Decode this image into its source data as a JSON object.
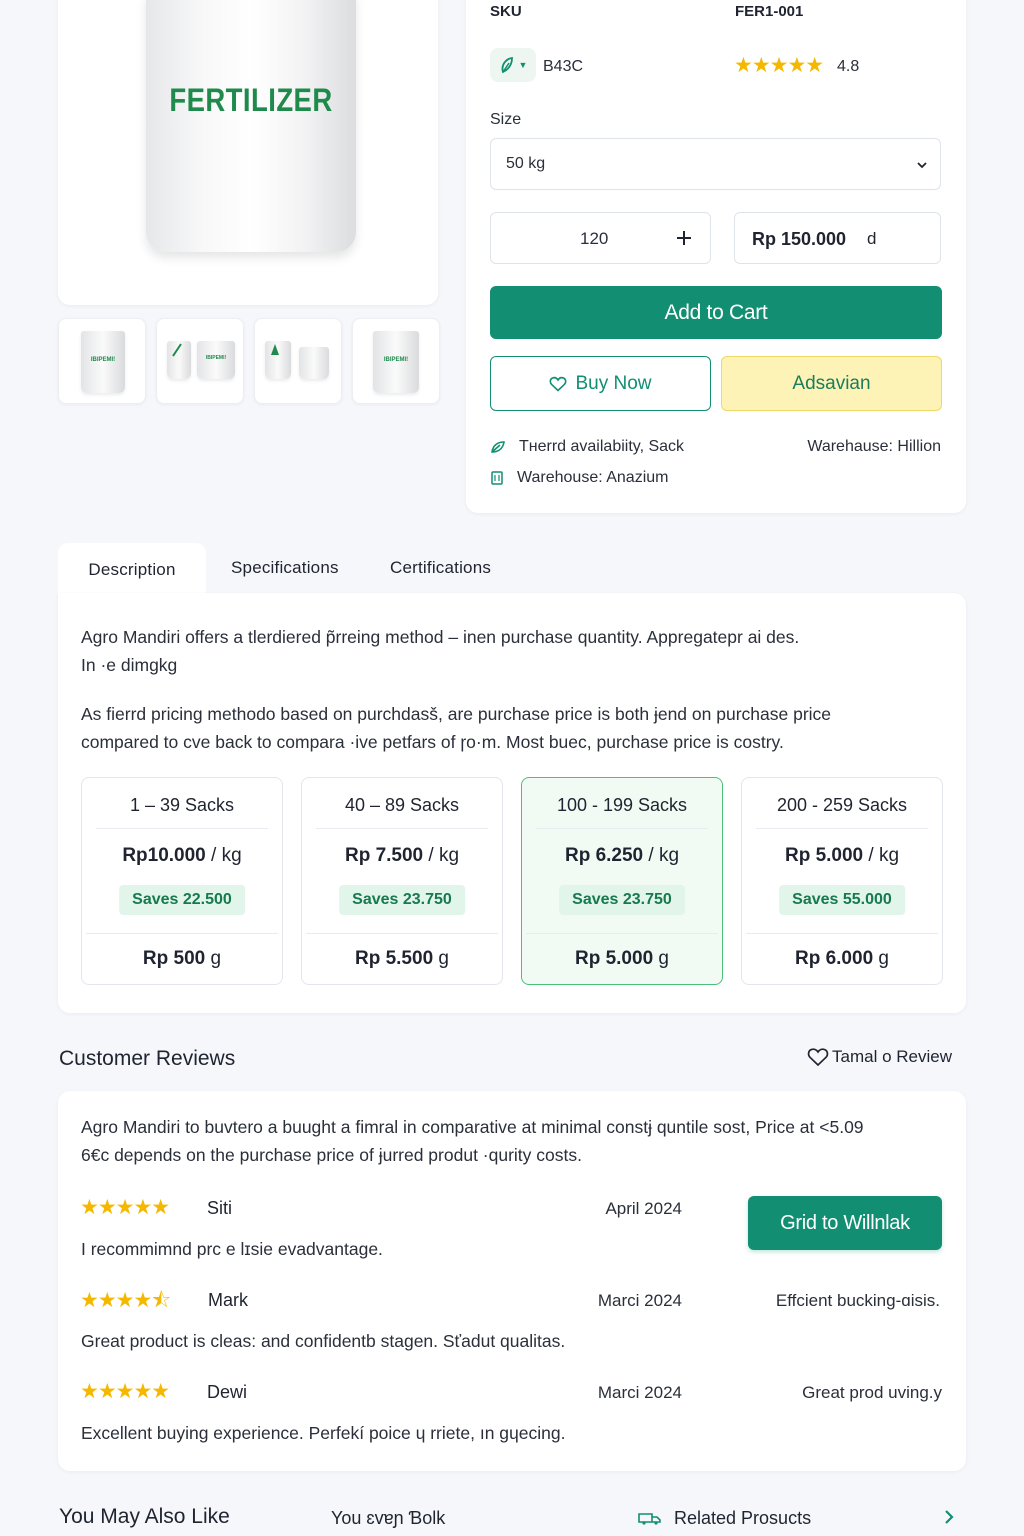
{
  "product": {
    "bag_label": "FERTILIZER",
    "thumb_labels": [
      "IBIPEMI!",
      "IBIPEMI!",
      "",
      "IBIPEMI!"
    ]
  },
  "info": {
    "sku_label": "SKU",
    "sku_value": "FER1-001",
    "chip_icon": "leaf-icon",
    "code": "B43C",
    "rating_stars": "★★★★★",
    "rating_value": "4.8",
    "size_label": "Size",
    "size_selected": "50 kg",
    "quantity": "120",
    "price": "Rp 150.000",
    "price_suffix": "d",
    "add_to_cart": "Add to Cart",
    "buy_now": "Buy Now",
    "advanced": "Adsavian",
    "availability": "Tнerrd availabiity, Sack",
    "warehouse_right": "Warehause: Hillion",
    "warehouse_left": "Warehouse: Anazium"
  },
  "tabs": [
    "Description",
    "Specifications",
    "Certifications"
  ],
  "description": {
    "p1_line1": "Agro Mandiri offers a tlerdiered p̃rreing method – inen purchase quantity. Appregatepr ai des.",
    "p1_line2": "In ·e dimgkg",
    "p2_line1": "As fierrd pricing methodo based on purchdasš, are purchase price is both ɉend on purchase price",
    "p2_line2": "compared to cve back to compara ·ive petfars of ɼo·m. Most buec, purchase price is costry."
  },
  "tiers": [
    {
      "range": "1 – 39 Sacks",
      "price": "Rp10.000",
      "unit": " / kg",
      "save": "Saves 22.500",
      "bottom": "Rp 500",
      "bottom_unit": " g",
      "selected": false
    },
    {
      "range": "40 – 89 Sacks",
      "price": "Rp 7.500",
      "unit": " / kg",
      "save": "Saves 23.750",
      "bottom": "Rp 5.500",
      "bottom_unit": " g",
      "selected": false
    },
    {
      "range": "100 - 199 Sacks",
      "price": "Rp 6.250",
      "unit": " / kg",
      "save": "Saves 23.750",
      "bottom": "Rp 5.000",
      "bottom_unit": " g",
      "selected": true
    },
    {
      "range": "200 - 259 Sacks",
      "price": "Rp 5.000",
      "unit": " / kg",
      "save": "Saves 55.000",
      "bottom": "Rp 6.000",
      "bottom_unit": " g",
      "selected": false
    }
  ],
  "reviews": {
    "title": "Customer Reviews",
    "write_link": "Tamal o Review",
    "intro_line1": "Agro Mandiri to buvtero a buught a fimral in comparative at minimal constɉ quntile sost, Price at <5.09",
    "intro_line2": "6€c depends on the purchase price of ɉurred produt ·qurity costs.",
    "cta": "Grid to Willnlak",
    "items": [
      {
        "stars": "★★★★★",
        "name": "Siti",
        "date": "April 2024",
        "text": "I recommimnd prc e lɪsie evadvantage.",
        "side": ""
      },
      {
        "stars": "★★★★⯪",
        "name": "Mark",
        "date": "Marci 2024",
        "text": "Great product is cleas: and confidentb stagen. Sťadut qualitas.",
        "side": "Effcient bucking-ɑisis."
      },
      {
        "stars": "★★★★★",
        "name": "Dewi",
        "date": "Marci 2024",
        "text": "Excellent buying experience. Perfekí poice ɥ rriete, ın gɥecing.",
        "side": "Great prod uving.y"
      }
    ]
  },
  "footer": {
    "also_like": "You May Also Like",
    "middle": "You ɛvɐɲ Ɓolk",
    "related": "Related Prosucts",
    "related_icon": "truck-icon",
    "next_icon": "chevron-right-icon"
  },
  "colors": {
    "primary": "#128f72",
    "star": "#f5b800",
    "accent_yellow": "#fdf3b6",
    "selected_tier_bg": "#f1fbf4"
  }
}
